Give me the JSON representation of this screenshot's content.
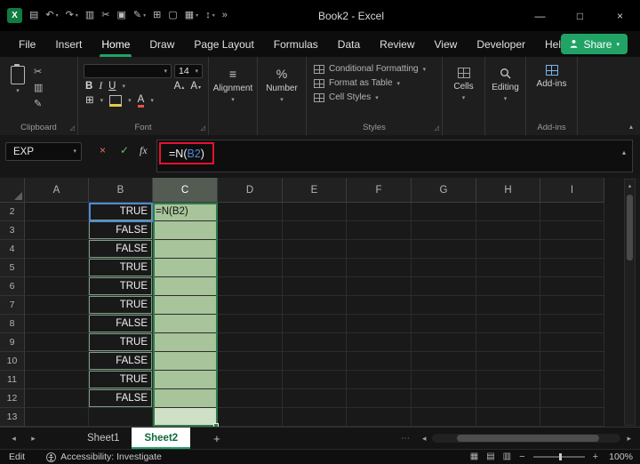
{
  "titlebar": {
    "title": "Book2 - Excel",
    "minimize_label": "—",
    "maximize_label": "□",
    "close_label": "×",
    "app_initial": "X",
    "qat_icons": [
      {
        "name": "save-icon",
        "glyph": "▤"
      },
      {
        "name": "undo-icon",
        "glyph": "↶",
        "dropdown": true
      },
      {
        "name": "redo-icon",
        "glyph": "↷",
        "dropdown": true
      },
      {
        "name": "copy-icon",
        "glyph": "▥"
      },
      {
        "name": "cut-icon",
        "glyph": "✂"
      },
      {
        "name": "picture-icon",
        "glyph": "▣"
      },
      {
        "name": "draw-icon",
        "glyph": "✎",
        "dropdown": true
      },
      {
        "name": "table-icon",
        "glyph": "⊞"
      },
      {
        "name": "camera-icon",
        "glyph": "▢"
      },
      {
        "name": "chart-icon",
        "glyph": "▦",
        "dropdown": true
      },
      {
        "name": "sort-icon",
        "glyph": "↕",
        "dropdown": true
      },
      {
        "name": "more-commands-icon",
        "glyph": "»"
      }
    ]
  },
  "ribbon_tabs": [
    {
      "label": "File",
      "active": false
    },
    {
      "label": "Insert",
      "active": false
    },
    {
      "label": "Home",
      "active": true
    },
    {
      "label": "Draw",
      "active": false
    },
    {
      "label": "Page Layout",
      "active": false
    },
    {
      "label": "Formulas",
      "active": false
    },
    {
      "label": "Data",
      "active": false
    },
    {
      "label": "Review",
      "active": false
    },
    {
      "label": "View",
      "active": false
    },
    {
      "label": "Developer",
      "active": false
    },
    {
      "label": "Help",
      "active": false
    }
  ],
  "share": {
    "label": "Share"
  },
  "ribbon": {
    "clipboard": {
      "group_label": "Clipboard"
    },
    "font": {
      "group_label": "Font",
      "size_value": "14",
      "bold_label": "B",
      "italic_label": "I",
      "underline_label": "U",
      "grow_font_label": "A",
      "shrink_font_label": "A",
      "font_color_label": "A"
    },
    "alignment": {
      "label": "Alignment",
      "icon": "≡"
    },
    "number": {
      "label": "Number",
      "icon": "%"
    },
    "styles": {
      "group_label": "Styles",
      "buttons": [
        "Conditional Formatting",
        "Format as Table",
        "Cell Styles"
      ]
    },
    "cells": {
      "label": "Cells"
    },
    "editing": {
      "label": "Editing"
    },
    "addins": {
      "label": "Add-ins",
      "group_label": "Add-ins"
    }
  },
  "formula_bar": {
    "name_box_value": "EXP",
    "cancel_glyph": "×",
    "enter_glyph": "✓",
    "fx_label": "fx",
    "formula_prefix": "=N(",
    "formula_ref": "B2",
    "formula_suffix": ")"
  },
  "grid": {
    "columns": [
      "A",
      "B",
      "C",
      "D",
      "E",
      "F",
      "G",
      "H",
      "I"
    ],
    "selected_column": "C",
    "rows": [
      {
        "n": "2",
        "b": "TRUE",
        "c": "=N(B2)",
        "c_style": "filled"
      },
      {
        "n": "3",
        "b": "FALSE",
        "c": "",
        "c_style": "filled"
      },
      {
        "n": "4",
        "b": "FALSE",
        "c": "",
        "c_style": "filled"
      },
      {
        "n": "5",
        "b": "TRUE",
        "c": "",
        "c_style": "filled"
      },
      {
        "n": "6",
        "b": "TRUE",
        "c": "",
        "c_style": "filled"
      },
      {
        "n": "7",
        "b": "TRUE",
        "c": "",
        "c_style": "filled"
      },
      {
        "n": "8",
        "b": "FALSE",
        "c": "",
        "c_style": "filled"
      },
      {
        "n": "9",
        "b": "TRUE",
        "c": "",
        "c_style": "filled"
      },
      {
        "n": "10",
        "b": "FALSE",
        "c": "",
        "c_style": "filled"
      },
      {
        "n": "11",
        "b": "TRUE",
        "c": "",
        "c_style": "filled"
      },
      {
        "n": "12",
        "b": "FALSE",
        "c": "",
        "c_style": "filled"
      },
      {
        "n": "13",
        "b": "",
        "c": "",
        "c_style": "filled-light"
      }
    ]
  },
  "sheet_bar": {
    "tabs": [
      {
        "label": "Sheet1",
        "active": false
      },
      {
        "label": "Sheet2",
        "active": true
      }
    ],
    "add_label": "+"
  },
  "status_bar": {
    "mode": "Edit",
    "accessibility": "Accessibility: Investigate",
    "zoom": "100%"
  },
  "colors": {
    "accent_green": "#21a366",
    "selection_fill": "#a7c49a",
    "selection_fill_light": "#cfe0c6",
    "selection_border": "#2c7a4b",
    "reference_blue": "#4d8ad6",
    "annotation_red": "#e8112d"
  }
}
